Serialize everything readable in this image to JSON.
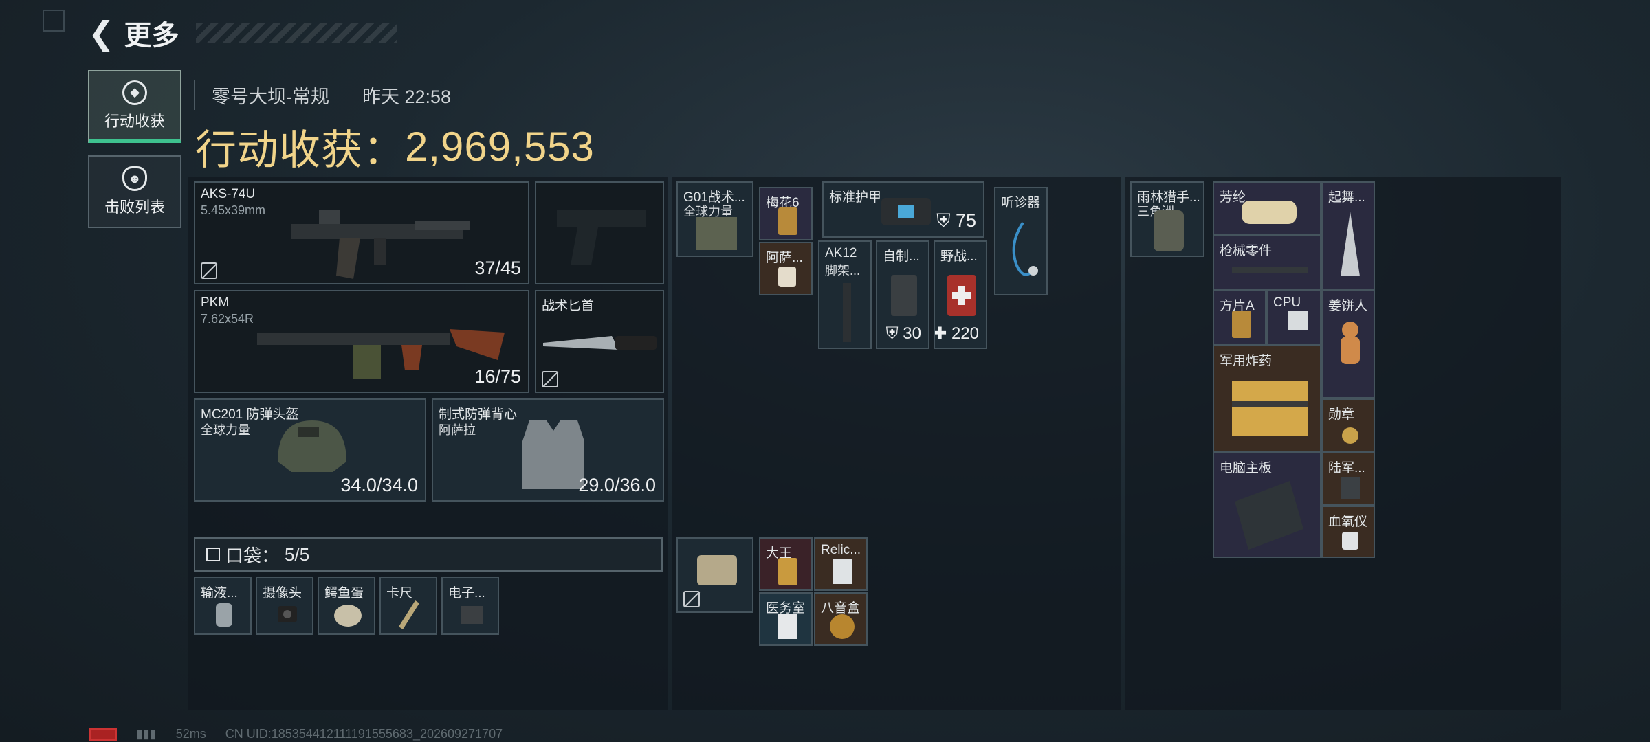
{
  "header": {
    "back_label": "更多"
  },
  "side_tabs": [
    {
      "label": "行动收获",
      "icon": "eye-scope-icon"
    },
    {
      "label": "击败列表",
      "icon": "skull-icon"
    }
  ],
  "session": {
    "map": "零号大坝-常规",
    "time": "昨天 22:58"
  },
  "haul": {
    "label": "行动收获：",
    "value": "2,969,553"
  },
  "loadout": {
    "primary1": {
      "name": "AKS-74U",
      "ammo_type": "5.45x39mm",
      "ammo": "37/45"
    },
    "primary2": {
      "name": "PKM",
      "ammo_type": "7.62x54R",
      "ammo": "16/75"
    },
    "knife": {
      "name": "战术匕首"
    },
    "helmet": {
      "name": "MC201 防弹头盔",
      "brand": "全球力量",
      "durability": "34.0/34.0"
    },
    "vest": {
      "name": "制式防弹背心",
      "brand": "阿萨拉",
      "durability": "29.0/36.0"
    },
    "pocket": {
      "label": "口袋：",
      "count": "5/5"
    },
    "pocket_items": [
      "输液...",
      "摄像头",
      "鳄鱼蛋",
      "卡尺",
      "电子..."
    ]
  },
  "rig": {
    "chest_rig": {
      "name": "G01战术...",
      "brand": "全球力量"
    },
    "items": [
      {
        "name": "梅花6"
      },
      {
        "name": "阿萨..."
      },
      {
        "name": "标准护甲",
        "value": "75"
      },
      {
        "name": "听诊器"
      },
      {
        "name": "AK12",
        "sub": "脚架..."
      },
      {
        "name": "自制...",
        "value": "30"
      },
      {
        "name": "野战...",
        "value": "220"
      }
    ],
    "box_items": [
      {
        "name": "大王"
      },
      {
        "name": "Relic..."
      },
      {
        "name": "医务室"
      },
      {
        "name": "八音盒"
      }
    ]
  },
  "backpack": {
    "bag": {
      "name": "雨林猎手...",
      "brand": "三角洲"
    },
    "items": [
      {
        "name": "芳纶"
      },
      {
        "name": "起舞..."
      },
      {
        "name": "枪械零件"
      },
      {
        "name": "方片A"
      },
      {
        "name": "CPU"
      },
      {
        "name": "姜饼人"
      },
      {
        "name": "军用炸药"
      },
      {
        "name": "勋章"
      },
      {
        "name": "电脑主板"
      },
      {
        "name": "陆军..."
      },
      {
        "name": "血氧仪"
      }
    ]
  },
  "status_bar": {
    "ping": "52ms",
    "uid": "CN UID:185354412111191555683_202609271707"
  },
  "colors": {
    "accent_gold": "#f1d48a",
    "tab_active": "#3ec28f"
  }
}
